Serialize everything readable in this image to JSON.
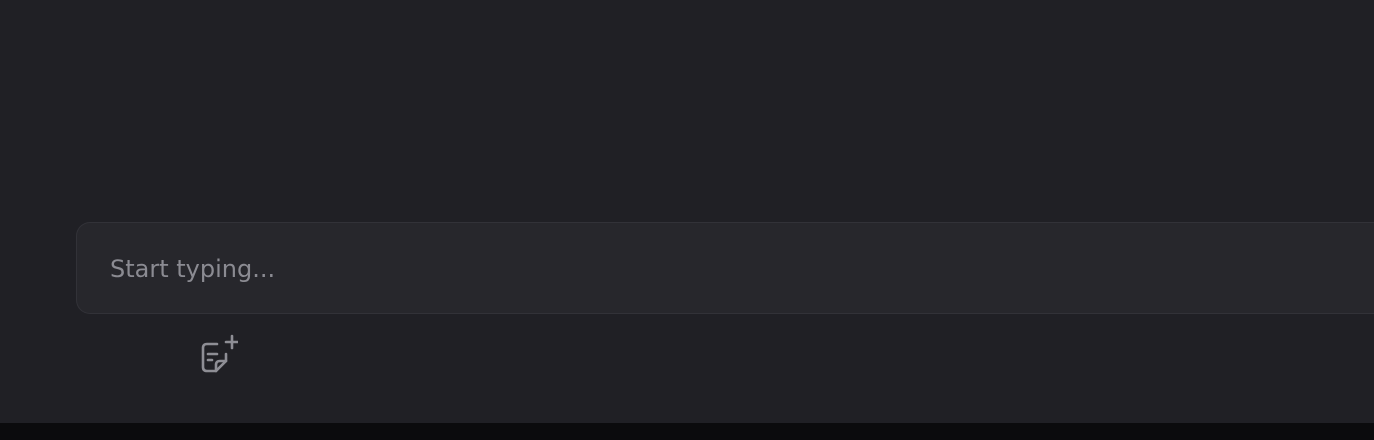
{
  "composer": {
    "placeholder": "Start typing..."
  },
  "toolbar": {
    "new_note_icon": "note-plus-icon"
  },
  "colors": {
    "background": "#202025",
    "composer_background": "#27272c",
    "composer_border": "#323238",
    "placeholder_text": "#8b8b92",
    "icon": "#8e8e95",
    "bottom_bar": "#0b0b0d"
  }
}
